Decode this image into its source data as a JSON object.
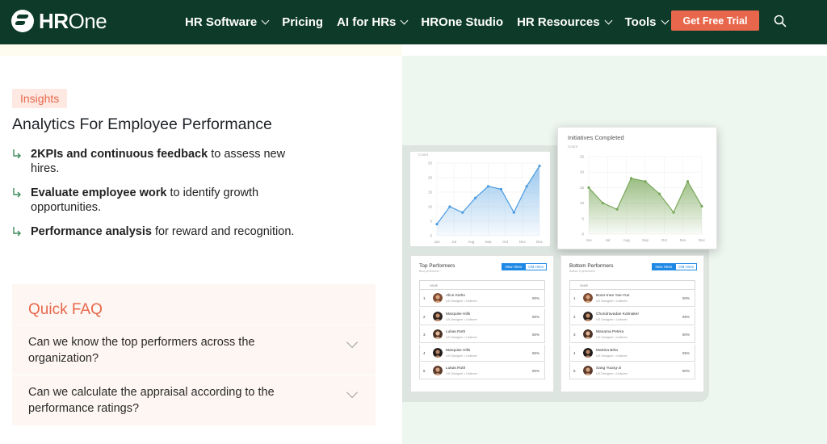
{
  "nav": {
    "logo_bold": "HR",
    "logo_light": "One",
    "items": [
      {
        "label": "HR Software",
        "has_dropdown": true
      },
      {
        "label": "Pricing",
        "has_dropdown": false
      },
      {
        "label": "AI for HRs",
        "has_dropdown": true
      },
      {
        "label": "HROne Studio",
        "has_dropdown": false
      },
      {
        "label": "HR Resources",
        "has_dropdown": true
      },
      {
        "label": "Tools",
        "has_dropdown": true
      }
    ],
    "cta_label": "Get Free Trial",
    "search_icon": "search-icon"
  },
  "content": {
    "pill": "Insights",
    "heading": "Analytics For Employee Performance",
    "bullets": [
      {
        "bold": "2KPIs and continuous feedback",
        "rest": " to assess new hires."
      },
      {
        "bold": "Evaluate employee work",
        "rest": " to identify growth opportunities."
      },
      {
        "bold": "Performance analysis",
        "rest": " for reward and recognition."
      }
    ]
  },
  "faq": {
    "title": "Quick FAQ",
    "items": [
      {
        "question": "Can we know the top performers across the organization?"
      },
      {
        "question": "Can we calculate the appraisal according to the performance ratings?"
      }
    ]
  },
  "dashboard": {
    "chart1": {
      "y_title": "Count",
      "y_ticks": [
        "25",
        "20",
        "15",
        "10",
        "5",
        "0"
      ],
      "x_labels": [
        "Jun",
        "Jul",
        "Aug",
        "Sep",
        "Oct",
        "Nov",
        "Dec"
      ],
      "values": [
        4,
        10,
        8,
        13,
        17,
        16,
        8,
        17,
        24
      ],
      "color": "#4a9be0"
    },
    "chart2": {
      "title": "Initiatives Completed",
      "y_title": "Count",
      "y_ticks": [
        "25",
        "20",
        "15",
        "10",
        "5",
        "0"
      ],
      "x_labels": [
        "Jun",
        "Jul",
        "Aug",
        "Sep",
        "Oct",
        "Nov",
        "Dec"
      ],
      "values": [
        15,
        10,
        8,
        18,
        17,
        13,
        7,
        17,
        9
      ],
      "color": "#7aa85a"
    },
    "top": {
      "title": "Top Performers",
      "subtitle": "Best performers",
      "toggle_on": "New Hires",
      "toggle_off": "Old Hires",
      "column": "NAME",
      "rows": [
        {
          "rank": "1",
          "name": "Alice Kiehn",
          "role": "UX Designer  •  Unilever",
          "pct": "90%"
        },
        {
          "rank": "2",
          "name": "Marquise Hills",
          "role": "UX Designer  •  Unilever",
          "pct": "85%"
        },
        {
          "rank": "3",
          "name": "Lukas Roth",
          "role": "UX Designer  •  Unilever",
          "pct": "80%"
        },
        {
          "rank": "4",
          "name": "Marquise Hills",
          "role": "UX Designer  •  Unilever",
          "pct": "85%"
        },
        {
          "rank": "5",
          "name": "Lukas Roth",
          "role": "UX Designer  •  Unilever",
          "pct": "80%"
        }
      ]
    },
    "bottom": {
      "title": "Bottom Performers",
      "subtitle": "Bottom 5 performers",
      "toggle_on": "New Hires",
      "toggle_off": "Old Hires",
      "column": "NAME",
      "rows": [
        {
          "rank": "1",
          "name": "Boon-mee Yao-Yun",
          "role": "UX Designer  •  Unilever",
          "pct": "90%"
        },
        {
          "rank": "2",
          "name": "Chondravadan Kalmaker",
          "role": "UX Designer  •  Unilever",
          "pct": "85%"
        },
        {
          "rank": "3",
          "name": "Manama Petera",
          "role": "UX Designer  •  Unilever",
          "pct": "80%"
        },
        {
          "rank": "4",
          "name": "Martina Brito",
          "role": "UX Designer  •  Unilever",
          "pct": "85%"
        },
        {
          "rank": "5",
          "name": "Sang Young-Ji",
          "role": "UX Designer  •  Unilever",
          "pct": "80%"
        }
      ]
    }
  },
  "colors": {
    "nav_bg": "#0e3a29",
    "accent": "#e8674c",
    "faq_bg": "#fef6f2",
    "right_bg": "#eef6f0"
  }
}
